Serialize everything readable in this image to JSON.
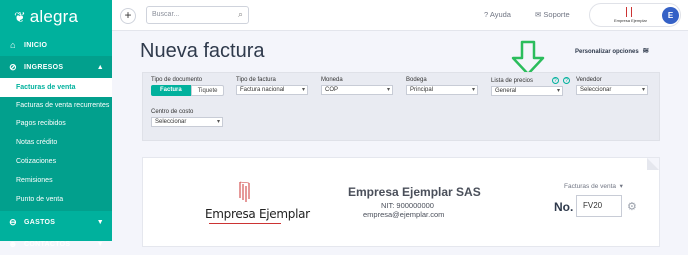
{
  "app": {
    "brand": "alegra"
  },
  "sidebar": {
    "items": [
      {
        "label": "INICIO"
      },
      {
        "label": "INGRESOS"
      },
      {
        "label": "GASTOS"
      },
      {
        "label": "CONTACTOS"
      }
    ],
    "sub_items": [
      "Facturas de venta",
      "Facturas de venta recurrentes",
      "Pagos recibidos",
      "Notas crédito",
      "Cotizaciones",
      "Remisiones",
      "Punto de venta"
    ]
  },
  "topbar": {
    "search_placeholder": "Buscar...",
    "help": "Ayuda",
    "support": "Soporte",
    "company_chip_name": "Empresa Ejemplar",
    "avatar_initial": "E"
  },
  "page": {
    "title": "Nueva factura",
    "customize": "Personalizar opciones"
  },
  "filters": {
    "doc_type_label": "Tipo de documento",
    "doc_type_on": "Factura",
    "doc_type_off": "Tiquete",
    "invoice_type_label": "Tipo de factura",
    "invoice_type_value": "Factura nacional",
    "currency_label": "Moneda",
    "currency_value": "COP",
    "warehouse_label": "Bodega",
    "warehouse_value": "Principal",
    "price_list_label": "Lista de precios",
    "price_list_value": "General",
    "seller_label": "Vendedor",
    "seller_value": "Seleccionar",
    "cost_center_label": "Centro de costo",
    "cost_center_value": "Seleccionar"
  },
  "invoice": {
    "logo_text": "Empresa Ejemplar",
    "company_name": "Empresa Ejemplar SAS",
    "nit": "NIT: 900000000",
    "email": "empresa@ejemplar.com",
    "doc_type": "Facturas de venta",
    "number_label": "No.",
    "number_value": "FV20"
  },
  "colors": {
    "accent": "#00b19d",
    "accent_dark": "#02a08d",
    "avatar": "#3561c6",
    "logo_red": "#cc3333"
  }
}
